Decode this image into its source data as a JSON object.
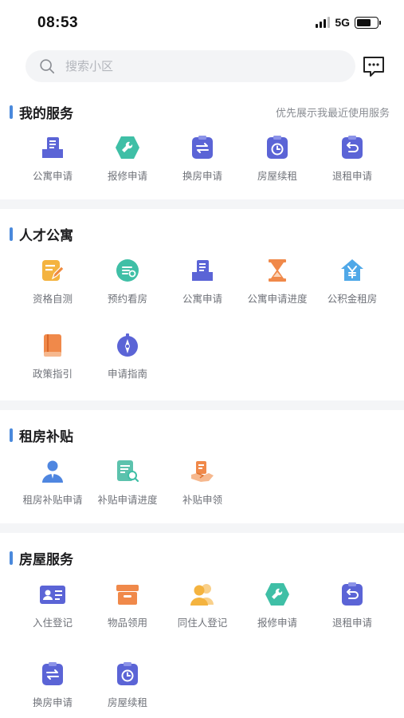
{
  "status": {
    "time": "08:53",
    "network": "5G"
  },
  "search": {
    "placeholder": "搜索小区"
  },
  "colors": {
    "accent": "#4a89dc",
    "indigo": "#5b64d6",
    "orange": "#f0894a",
    "teal": "#3fbfa6",
    "yellow": "#f4b33f",
    "page_bg": "#f4f5f7"
  },
  "sections": [
    {
      "title": "我的服务",
      "note": "优先展示我最近使用服务",
      "items": [
        {
          "label": "公寓申请",
          "icon": "apartment-icon"
        },
        {
          "label": "报修申请",
          "icon": "wrench-icon"
        },
        {
          "label": "换房申请",
          "icon": "swap-icon"
        },
        {
          "label": "房屋续租",
          "icon": "clock-icon"
        },
        {
          "label": "退租申请",
          "icon": "return-icon"
        }
      ]
    },
    {
      "title": "人才公寓",
      "items": [
        {
          "label": "资格自测",
          "icon": "edit-icon"
        },
        {
          "label": "预约看房",
          "icon": "appointment-icon"
        },
        {
          "label": "公寓申请",
          "icon": "apartment-icon"
        },
        {
          "label": "公寓申请进度",
          "icon": "hourglass-icon"
        },
        {
          "label": "公积金租房",
          "icon": "fund-house-icon"
        },
        {
          "label": "政策指引",
          "icon": "book-icon"
        },
        {
          "label": "申请指南",
          "icon": "compass-icon"
        }
      ]
    },
    {
      "title": "租房补贴",
      "items": [
        {
          "label": "租房补贴申请",
          "icon": "person-icon"
        },
        {
          "label": "补贴申请进度",
          "icon": "doc-search-icon"
        },
        {
          "label": "补贴申领",
          "icon": "hand-receive-icon"
        }
      ]
    },
    {
      "title": "房屋服务",
      "items": [
        {
          "label": "入住登记",
          "icon": "id-card-icon"
        },
        {
          "label": "物品领用",
          "icon": "box-icon"
        },
        {
          "label": "同住人登记",
          "icon": "people-icon"
        },
        {
          "label": "报修申请",
          "icon": "wrench-icon"
        },
        {
          "label": "退租申请",
          "icon": "return-icon"
        },
        {
          "label": "换房申请",
          "icon": "swap-icon"
        },
        {
          "label": "房屋续租",
          "icon": "clock-icon"
        }
      ]
    }
  ]
}
